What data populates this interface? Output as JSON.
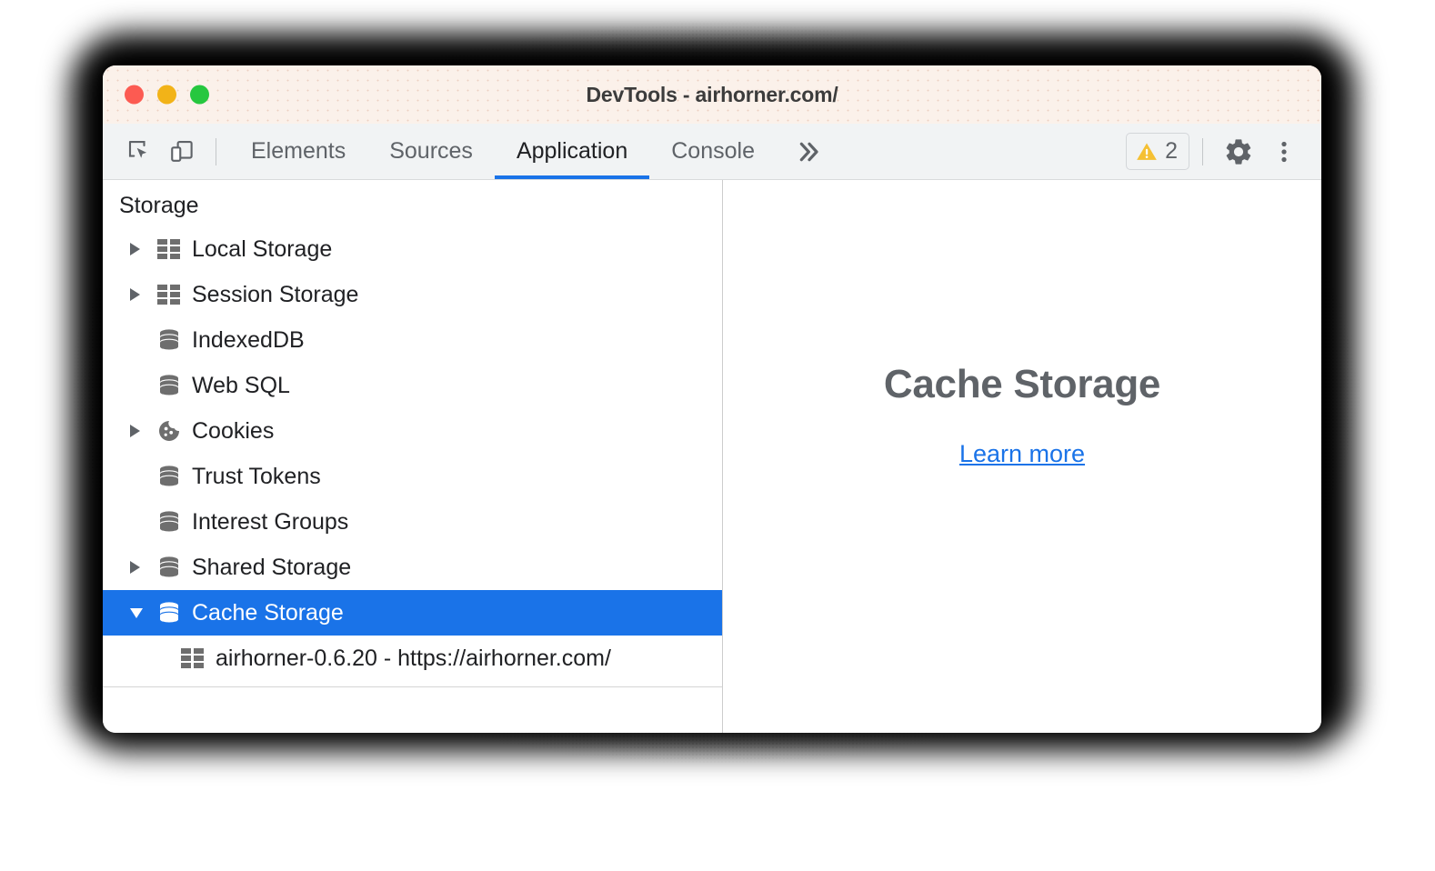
{
  "window": {
    "title": "DevTools - airhorner.com/",
    "traffic_lights": [
      {
        "name": "close",
        "color": "#fc5b52"
      },
      {
        "name": "minimize",
        "color": "#f2b318"
      },
      {
        "name": "zoom",
        "color": "#26c73f"
      }
    ]
  },
  "toolbar": {
    "inspect_icon": "inspect-element-icon",
    "device_icon": "device-toolbar-icon",
    "tabs": [
      {
        "label": "Elements",
        "active": false
      },
      {
        "label": "Sources",
        "active": false
      },
      {
        "label": "Application",
        "active": true
      },
      {
        "label": "Console",
        "active": false
      }
    ],
    "more_tabs_glyph": "»",
    "warnings": {
      "icon": "warning-triangle-icon",
      "count": "2",
      "color": "#f5c033"
    },
    "settings_icon": "gear-icon",
    "menu_icon": "kebab-menu-icon",
    "accent_color": "#1a73e8"
  },
  "sidebar": {
    "header": "Storage",
    "items": [
      {
        "label": "Local Storage",
        "icon": "table-grid-icon",
        "expandable": true,
        "expanded": false,
        "selected": false,
        "child": false
      },
      {
        "label": "Session Storage",
        "icon": "table-grid-icon",
        "expandable": true,
        "expanded": false,
        "selected": false,
        "child": false
      },
      {
        "label": "IndexedDB",
        "icon": "database-icon",
        "expandable": false,
        "expanded": false,
        "selected": false,
        "child": false
      },
      {
        "label": "Web SQL",
        "icon": "database-icon",
        "expandable": false,
        "expanded": false,
        "selected": false,
        "child": false
      },
      {
        "label": "Cookies",
        "icon": "cookie-icon",
        "expandable": true,
        "expanded": false,
        "selected": false,
        "child": false
      },
      {
        "label": "Trust Tokens",
        "icon": "database-icon",
        "expandable": false,
        "expanded": false,
        "selected": false,
        "child": false
      },
      {
        "label": "Interest Groups",
        "icon": "database-icon",
        "expandable": false,
        "expanded": false,
        "selected": false,
        "child": false
      },
      {
        "label": "Shared Storage",
        "icon": "database-icon",
        "expandable": true,
        "expanded": false,
        "selected": false,
        "child": false
      },
      {
        "label": "Cache Storage",
        "icon": "database-icon",
        "expandable": true,
        "expanded": true,
        "selected": true,
        "child": false
      },
      {
        "label": "airhorner-0.6.20 - https://airhorner.com/",
        "icon": "table-grid-icon",
        "expandable": false,
        "expanded": false,
        "selected": false,
        "child": true
      }
    ],
    "selection_color": "#1a73e8"
  },
  "main": {
    "title": "Cache Storage",
    "link": "Learn more",
    "link_color": "#1a73e8"
  }
}
